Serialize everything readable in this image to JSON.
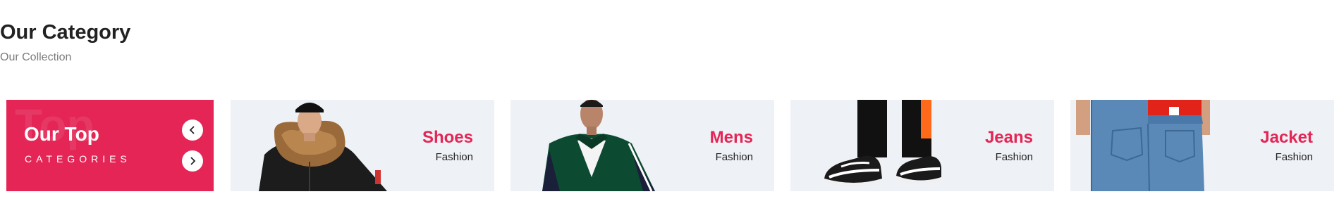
{
  "section": {
    "title": "Our Category",
    "subtitle": "Our Collection"
  },
  "promo": {
    "watermark": "Top",
    "title": "Our Top",
    "subtitle": "CATEGORIES",
    "background_color": "#e42555",
    "prev_icon": "chevron-left-icon",
    "next_icon": "chevron-right-icon"
  },
  "categories": [
    {
      "name": "Shoes",
      "sub": "Fashion",
      "image": "man-in-fur-hood-jacket"
    },
    {
      "name": "Mens",
      "sub": "Fashion",
      "image": "man-in-green-track-jacket"
    },
    {
      "name": "Jeans",
      "sub": "Fashion",
      "image": "black-white-sneakers"
    },
    {
      "name": "Jacket",
      "sub": "Fashion",
      "image": "woman-in-blue-jeans"
    }
  ],
  "colors": {
    "accent": "#e42555",
    "card_bg": "#eef1f6",
    "title_text": "#222222",
    "subtitle_text": "#7a7a7a"
  }
}
